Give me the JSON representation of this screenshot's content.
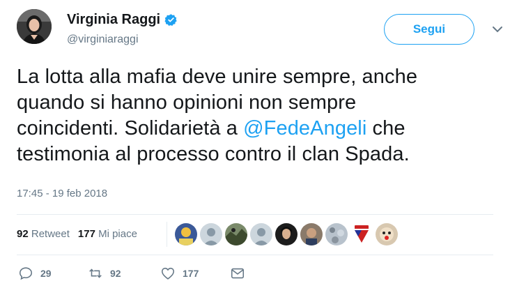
{
  "user": {
    "name": "Virginia Raggi",
    "handle": "@virginiaraggi"
  },
  "follow_label": "Segui",
  "tweet": {
    "line1": "La lotta alla mafia deve unire sempre, anche",
    "line2": "quando si hanno opinioni non sempre",
    "line3_pre": "coincidenti. Solidarietà a ",
    "line3_mention": "@FedeAngeli",
    "line3_post": " che",
    "line4": "testimonia al processo contro il clan Spada."
  },
  "timestamp": "17:45 - 19 feb 2018",
  "stats": {
    "retweets_count": "92",
    "retweets_label": " Retweet",
    "likes_count": "177",
    "likes_label": " Mi piace"
  },
  "likers": [
    {
      "icon": "liker-avatar-1",
      "color": "#3b5998"
    },
    {
      "icon": "default-avatar",
      "color": "#aab8c2"
    },
    {
      "icon": "liker-avatar-3",
      "color": "#556b2f"
    },
    {
      "icon": "default-avatar",
      "color": "#aab8c2"
    },
    {
      "icon": "liker-avatar-5",
      "color": "#222222"
    },
    {
      "icon": "liker-avatar-6",
      "color": "#5a4a3a"
    },
    {
      "icon": "liker-avatar-7",
      "color": "#9aa4ae"
    },
    {
      "icon": "liker-avatar-8",
      "color": "#cc2222"
    },
    {
      "icon": "liker-avatar-9",
      "color": "#c8b49a"
    }
  ],
  "actions": {
    "replies": "29",
    "retweets": "92",
    "likes": "177"
  },
  "colors": {
    "accent": "#1da1f2",
    "secondary_text": "#657786",
    "primary_text": "#14171a"
  }
}
